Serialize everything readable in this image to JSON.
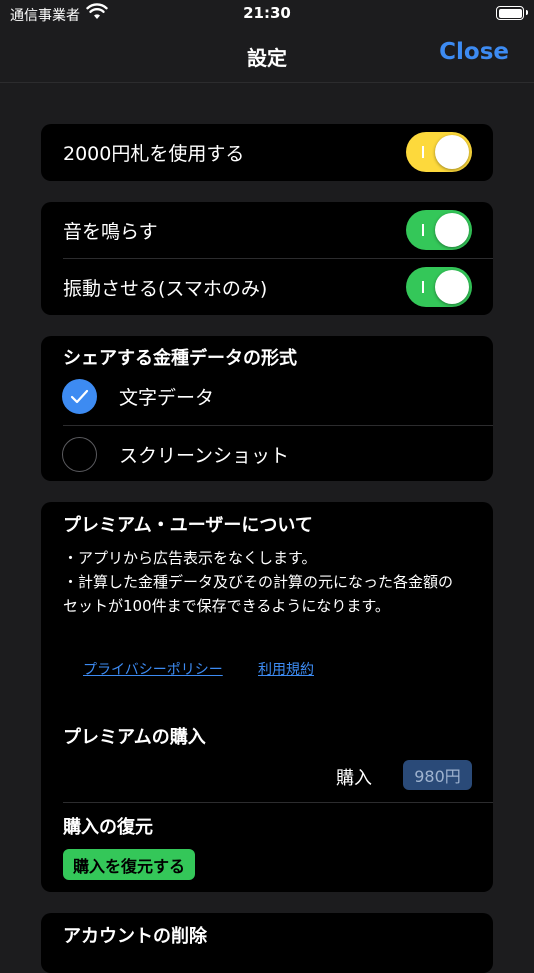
{
  "status_bar": {
    "carrier": "通信事業者",
    "time": "21:30"
  },
  "nav": {
    "title": "設定",
    "close_label": "Close"
  },
  "card1": {
    "label": "2000円札を使用する",
    "toggle_on": true,
    "color": "#fdd93c"
  },
  "card2": {
    "rows": [
      {
        "label": "音を鳴らす",
        "toggle_on": true
      },
      {
        "label": "振動させる(スマホのみ)",
        "toggle_on": true
      }
    ],
    "toggle_color": "#34c759"
  },
  "share_format": {
    "heading": "シェアする金種データの形式",
    "options": [
      {
        "label": "文字データ",
        "selected": true
      },
      {
        "label": "スクリーンショット",
        "selected": false
      }
    ]
  },
  "premium": {
    "heading": "プレミアム・ユーザーについて",
    "desc_line1": "・アプリから広告表示をなくします。",
    "desc_line2": "・計算した金種データ及びその計算の元になった各金額のセットが100件まで保存できるようになります。",
    "privacy_link": "プライバシーポリシー",
    "terms_link": "利用規約",
    "purchase_heading": "プレミアムの購入",
    "purchase_label": "購入",
    "price": "980円",
    "restore_heading": "購入の復元",
    "restore_button": "購入を復元する"
  },
  "account": {
    "heading": "アカウントの削除"
  }
}
